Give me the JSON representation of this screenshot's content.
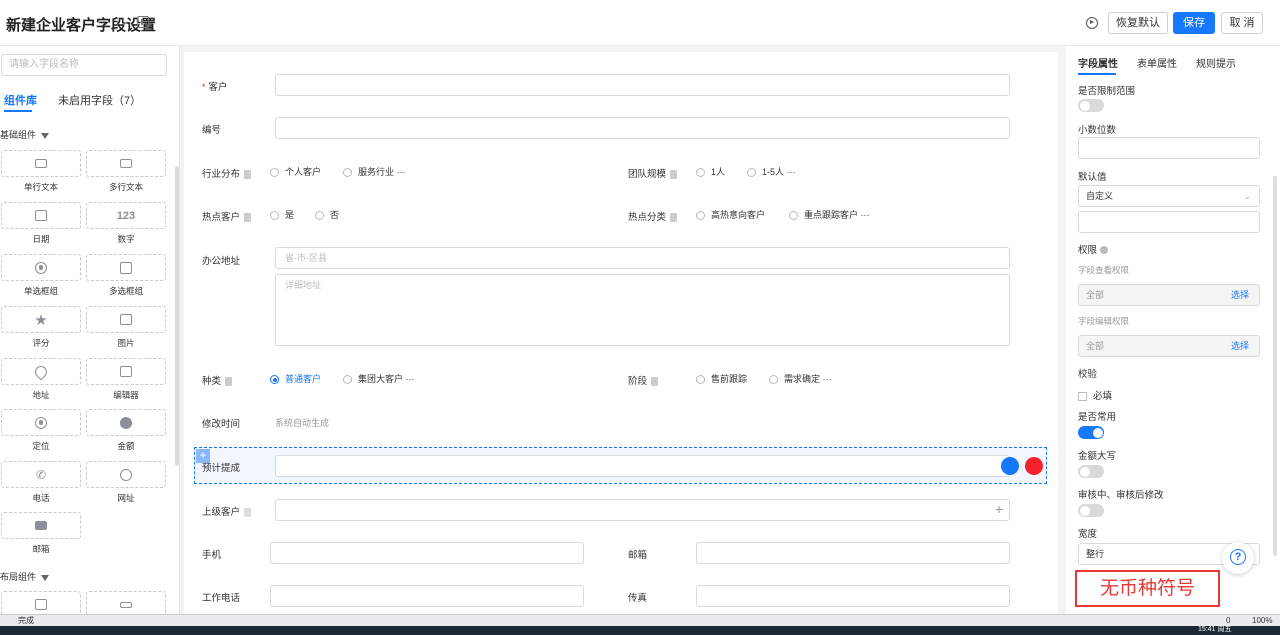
{
  "header": {
    "title": "新建企业客户字段设置",
    "restore_label": "恢复默认",
    "save_label": "保存",
    "cancel_label": "取 消"
  },
  "left": {
    "search_placeholder": "请输入字段名称",
    "tabs": [
      "组件库",
      "未启用字段（7）"
    ],
    "group_basic": "基础组件",
    "group_layout": "布局组件",
    "components": [
      {
        "label": "单行文本",
        "icon": "single-line-text-icon"
      },
      {
        "label": "多行文本",
        "icon": "multi-line-text-icon"
      },
      {
        "label": "日期",
        "icon": "calendar-icon"
      },
      {
        "label": "数字",
        "icon": "number-icon",
        "glyph": "123"
      },
      {
        "label": "单选框组",
        "icon": "radio-icon"
      },
      {
        "label": "多选框组",
        "icon": "checkbox-icon"
      },
      {
        "label": "评分",
        "icon": "star-icon"
      },
      {
        "label": "图片",
        "icon": "image-icon"
      },
      {
        "label": "地址",
        "icon": "location-pin-icon"
      },
      {
        "label": "编辑器",
        "icon": "editor-icon"
      },
      {
        "label": "定位",
        "icon": "locate-icon"
      },
      {
        "label": "金额",
        "icon": "amount-icon"
      },
      {
        "label": "电话",
        "icon": "phone-icon"
      },
      {
        "label": "网址",
        "icon": "globe-icon"
      },
      {
        "label": "邮箱",
        "icon": "mail-icon"
      }
    ]
  },
  "form": {
    "customer_label": "客户",
    "required_mark": "*",
    "code_label": "编号",
    "industry_label": "行业分布",
    "industry_options": [
      "个人客户",
      "服务行业"
    ],
    "team_label": "团队规模",
    "team_options": [
      "1人",
      "1-5人"
    ],
    "hot_customer_label": "热点客户",
    "hot_customer_options": [
      "是",
      "否"
    ],
    "hot_category_label": "热点分类",
    "hot_category_options": [
      "高热意向客户",
      "重点跟踪客户"
    ],
    "address_label": "办公地址",
    "address_region_placeholder": "省-市-区县",
    "address_detail_placeholder": "详细地址",
    "type_label": "种类",
    "type_options": [
      "普通客户",
      "集团大客户"
    ],
    "stage_label": "阶段",
    "stage_options": [
      "售前跟踪",
      "需求确定"
    ],
    "modified_label": "修改时间",
    "modified_value": "系统自动生成",
    "commission_label": "预计提成",
    "parent_label": "上级客户",
    "phone_label": "手机",
    "email_label": "邮箱",
    "workphone_label": "工作电话",
    "fax_label": "传真",
    "more": "···"
  },
  "right": {
    "tabs": [
      "字段属性",
      "表单属性",
      "规则提示"
    ],
    "limit_range_label": "是否限制范围",
    "decimals_label": "小数位数",
    "default_label": "默认值",
    "default_value": "自定义",
    "permission_label": "权限",
    "view_perm_label": "字段查看权限",
    "view_perm_value": "全部",
    "choose_label": "选择",
    "edit_perm_label": "字段编辑权限",
    "edit_perm_value": "全部",
    "validate_label": "校验",
    "required_label": "必填",
    "common_label": "是否常用",
    "uppercase_label": "金额大写",
    "audit_label": "审核中、审核后修改",
    "width_label": "宽度",
    "width_value": "整行",
    "toggles": {
      "limit_range": false,
      "common": true,
      "uppercase": false,
      "audit": false
    }
  },
  "annotation": "无币种符号",
  "status": {
    "text": "完成",
    "zoom": "100%",
    "time": "15:41 周五",
    "count": "0"
  },
  "colors": {
    "accent": "#1677ff",
    "annotation": "#e53935",
    "danger": "#f5222d"
  }
}
